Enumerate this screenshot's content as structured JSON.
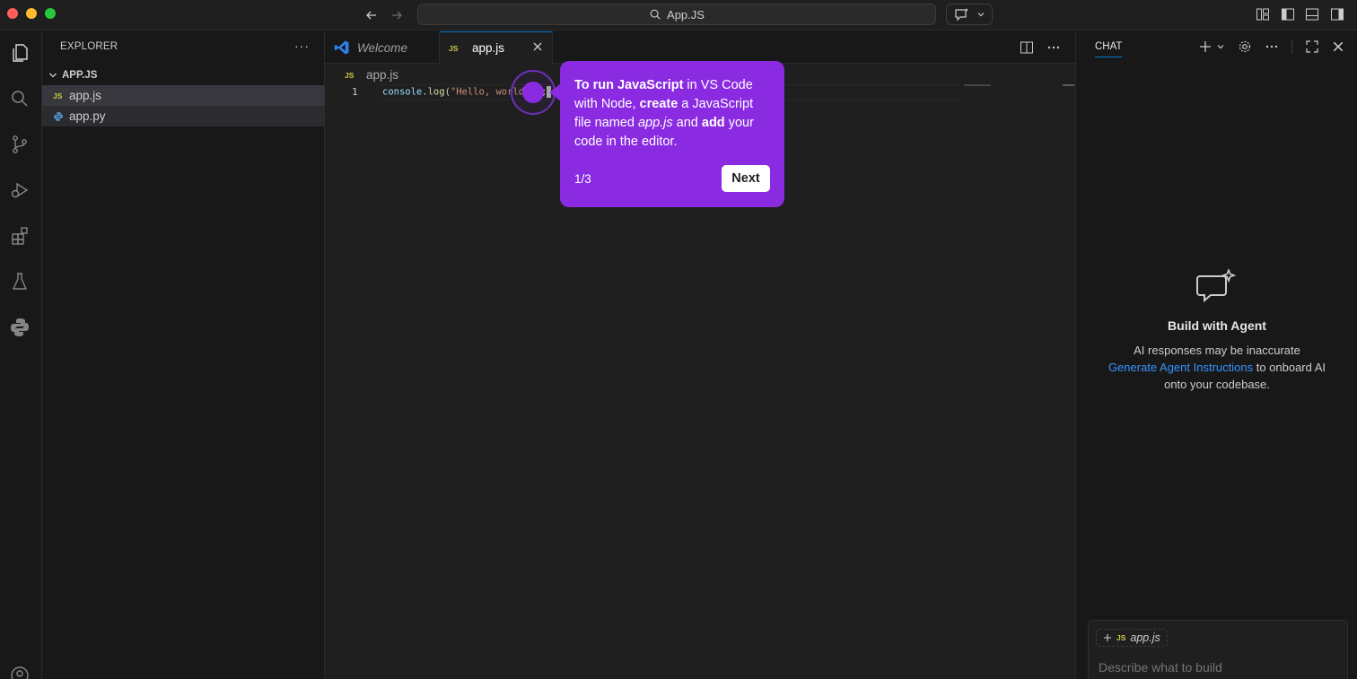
{
  "window": {
    "title": "App.JS"
  },
  "sidebar": {
    "header": "EXPLORER",
    "more": "···",
    "section_title": "APP.JS",
    "files": [
      {
        "name": "app.js",
        "badge": "JS"
      },
      {
        "name": "app.py",
        "badge": "py"
      }
    ]
  },
  "tabs": [
    {
      "label": "Welcome"
    },
    {
      "label": "app.js",
      "badge": "JS"
    }
  ],
  "editor": {
    "breadcrumb": "app.js",
    "breadcrumb_badge": "JS",
    "line_number": "1",
    "code": {
      "obj": "console",
      "dot": ".",
      "fn": "log",
      "open": "(",
      "str": "\"Hello, world!\"",
      "close": ");"
    }
  },
  "tour": {
    "p1_bold": "To run JavaScript",
    "p1_rest": " in VS Code with Node, ",
    "p2_bold": "create",
    "p2_rest": " a JavaScript file named ",
    "p3_italic": "app.js",
    "p3_rest": " and ",
    "p4_bold": "add",
    "p4_rest": " your code in the editor.",
    "step": "1/3",
    "next_label": "Next"
  },
  "chat": {
    "title": "CHAT",
    "heading": "Build with Agent",
    "disclaimer": "AI responses may be inaccurate",
    "link": "Generate Agent Instructions",
    "link_rest": " to onboard AI",
    "link_rest2": "onto your codebase.",
    "context_badge": "JS",
    "context_file": "app.js",
    "input_placeholder": "Describe what to build"
  },
  "colors": {
    "accent": "#0078d4",
    "tour": "#8a2be2",
    "js_badge": "#cbcb41",
    "link": "#3794ff"
  }
}
